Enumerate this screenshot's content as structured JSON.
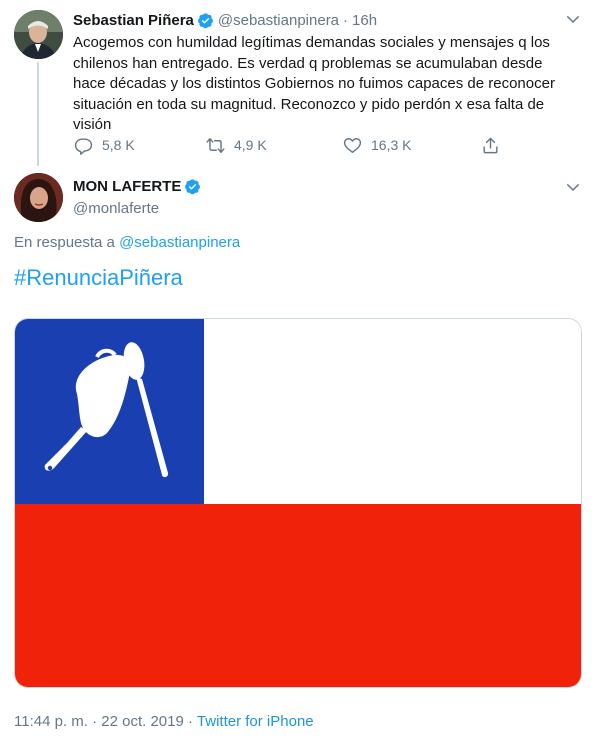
{
  "parent_tweet": {
    "display_name": "Sebastian Piñera",
    "handle": "@sebastianpinera",
    "separator": "·",
    "time": "16h",
    "text": "Acogemos con humildad legítimas demandas sociales y mensajes q los chilenos han entregado. Es verdad q problemas se acumulaban desde hace décadas y los distintos Gobiernos no fuimos capaces de reconocer situación en toda su magnitud. Reconozco y pido perdón x esa falta de visión",
    "replies": "5,8 K",
    "retweets": "4,9 K",
    "likes": "16,3 K"
  },
  "tweet": {
    "display_name": "MON LAFERTE",
    "handle": "@monlaferte",
    "reply_prefix": "En respuesta a",
    "reply_handle": "@sebastianpinera",
    "hashtag": "#RenunciaPiñera",
    "timestamp": "11:44 p. m. · 22 oct. 2019",
    "separator": "·",
    "source": "Twitter for iPhone"
  },
  "colors": {
    "link_blue": "#1da1f2",
    "verified_blue": "#1da1f2",
    "flag_blue": "#1a3fb0",
    "flag_red": "#f0220a",
    "flag_white": "#ffffff"
  },
  "icons": [
    "verified-badge-icon",
    "chevron-down-icon",
    "reply-icon",
    "retweet-icon",
    "like-icon",
    "share-icon",
    "pot-icon",
    "spoon-icon"
  ]
}
